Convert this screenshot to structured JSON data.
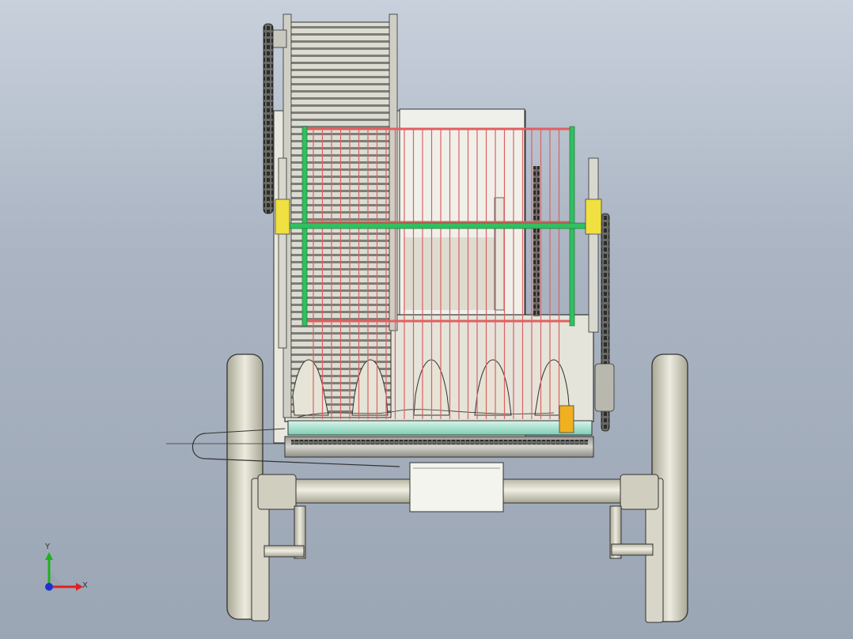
{
  "viewport": {
    "background_top": "#c8d0dc",
    "background_bottom": "#9ba6b5"
  },
  "triad": {
    "x_label": "X",
    "y_label": "Y",
    "x_color": "#e02020",
    "y_color": "#20b020",
    "z_color": "#2030d0"
  },
  "model": {
    "frame_color": "#d8d6c8",
    "frame_edge": "#3a3a3a",
    "guard_rail_color": "#e06060",
    "guard_post_color": "#30c060",
    "clamp_color": "#f0e040",
    "tag_color": "#f0b020",
    "screw_color": "#b8e8d8",
    "icon": "mechanical-assembly-icon"
  }
}
